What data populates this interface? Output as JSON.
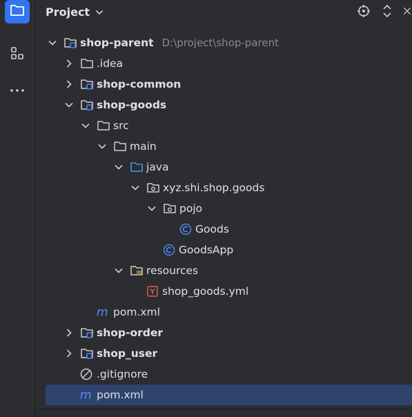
{
  "header": {
    "title": "Project"
  },
  "tree": [
    {
      "id": "r0",
      "label": "shop-parent",
      "path": "D:\\project\\shop-parent",
      "bold": true,
      "icon": "module-folder-icon",
      "expanded": true
    },
    {
      "id": "r1",
      "label": ".idea",
      "bold": false,
      "icon": "folder-icon",
      "expanded": false
    },
    {
      "id": "r2",
      "label": "shop-common",
      "bold": true,
      "icon": "module-folder-icon",
      "expanded": false
    },
    {
      "id": "r3",
      "label": "shop-goods",
      "bold": true,
      "icon": "module-folder-icon",
      "expanded": true
    },
    {
      "id": "r4",
      "label": "src",
      "bold": false,
      "icon": "folder-icon",
      "expanded": true
    },
    {
      "id": "r5",
      "label": "main",
      "bold": false,
      "icon": "folder-icon",
      "expanded": true
    },
    {
      "id": "r6",
      "label": "java",
      "bold": false,
      "icon": "source-root-folder-icon",
      "expanded": true
    },
    {
      "id": "r7",
      "label": "xyz.shi.shop.goods",
      "bold": false,
      "icon": "package-icon",
      "expanded": true
    },
    {
      "id": "r8",
      "label": "pojo",
      "bold": false,
      "icon": "package-icon",
      "expanded": true
    },
    {
      "id": "r9",
      "label": "Goods",
      "bold": false,
      "icon": "java-class-icon"
    },
    {
      "id": "r10",
      "label": "GoodsApp",
      "bold": false,
      "icon": "java-class-icon"
    },
    {
      "id": "r11",
      "label": "resources",
      "bold": false,
      "icon": "resources-folder-icon",
      "expanded": true
    },
    {
      "id": "r12",
      "label": "shop_goods.yml",
      "bold": false,
      "icon": "yaml-file-icon"
    },
    {
      "id": "r13",
      "label": "pom.xml",
      "bold": false,
      "icon": "maven-icon"
    },
    {
      "id": "r14",
      "label": "shop-order",
      "bold": true,
      "icon": "module-folder-icon",
      "expanded": false
    },
    {
      "id": "r15",
      "label": "shop_user",
      "bold": true,
      "icon": "module-folder-icon",
      "expanded": false
    },
    {
      "id": "r16",
      "label": ".gitignore",
      "bold": false,
      "icon": "ignored-file-icon"
    },
    {
      "id": "r17",
      "label": "pom.xml",
      "bold": false,
      "icon": "maven-icon",
      "selected": true
    }
  ],
  "colors": {
    "accent": "#3574f0",
    "selection": "#2e436e",
    "background": "#2b2d30",
    "javaClass": "#548af7",
    "yaml": "#e55c5c"
  }
}
